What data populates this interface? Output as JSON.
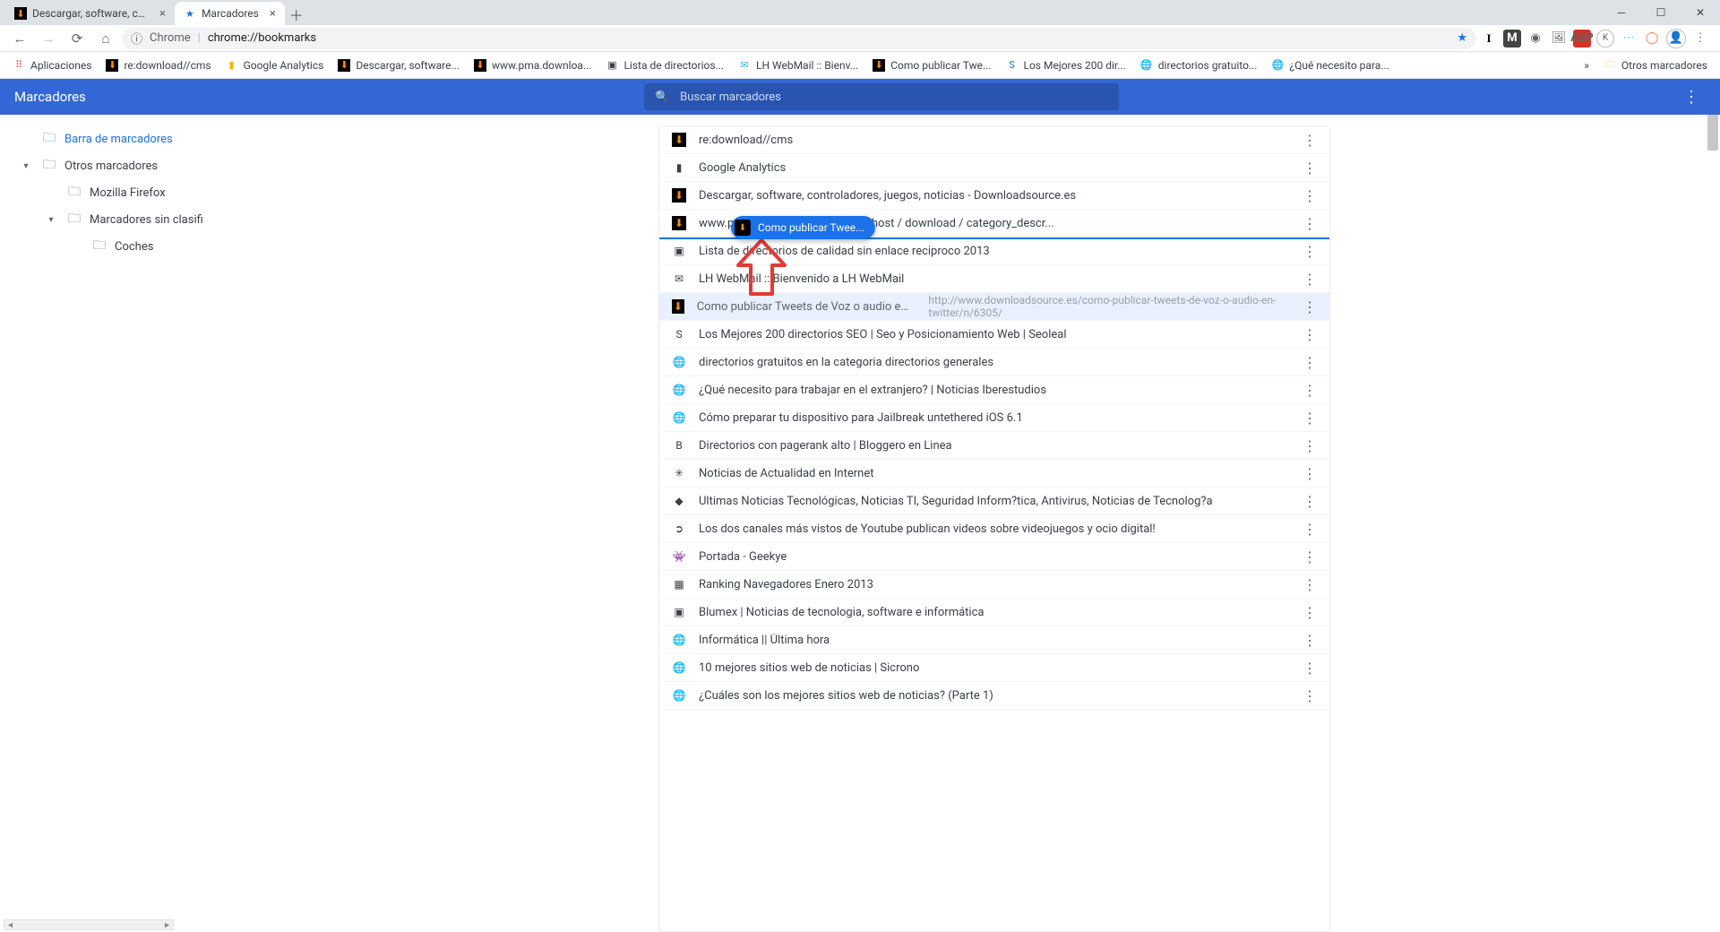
{
  "tabs": [
    {
      "label": "Descargar, software, controlador",
      "icon_bg": "ic-orange"
    },
    {
      "label": "Marcadores",
      "icon_bg": "ic-blue-star"
    }
  ],
  "address": {
    "scheme": "Chrome",
    "path": "chrome://bookmarks"
  },
  "bookbar": {
    "apps": "Aplicaciones",
    "items": [
      "re:download//cms",
      "Google Analytics",
      "Descargar, software...",
      "www.pma.downloa...",
      "Lista de directorios...",
      "LH WebMail :: Bienv...",
      "Como publicar Twe...",
      "Los Mejores 200 dir...",
      "directorios gratuito...",
      "¿Qué necesito para..."
    ],
    "overflow": "»",
    "other": "Otros marcadores"
  },
  "page": {
    "title": "Marcadores",
    "search_placeholder": "Buscar marcadores"
  },
  "tree": [
    {
      "label": "Barra de marcadores",
      "level": 0,
      "active": true,
      "caret": ""
    },
    {
      "label": "Otros marcadores",
      "level": 1,
      "active": false,
      "caret": "▾"
    },
    {
      "label": "Mozilla Firefox",
      "level": 2,
      "active": false,
      "caret": ""
    },
    {
      "label": "Marcadores sin clasifi",
      "level": 2,
      "active": false,
      "caret": "▾"
    },
    {
      "label": "Coches",
      "level": 3,
      "active": false,
      "caret": ""
    }
  ],
  "drag_chip": "Como publicar Twee...",
  "list": [
    {
      "title": "re:download//cms",
      "fav": "⬇",
      "fav_cls": "ic-orange"
    },
    {
      "title": "Google Analytics",
      "fav": "▮",
      "fav_cls": ""
    },
    {
      "title": "Descargar, software, controladores, juegos, noticias - Downloadsource.es",
      "fav": "⬇",
      "fav_cls": "ic-orange"
    },
    {
      "title": "www.pma.download.net.pl / localhost / download / category_descr...",
      "fav": "⬇",
      "fav_cls": "ic-orange"
    },
    {
      "title": "Lista de directorios de calidad sin enlace reciproco 2013",
      "fav": "▣",
      "fav_cls": ""
    },
    {
      "title": "LH WebMail :: Bienvenido a LH WebMail",
      "fav": "✉",
      "fav_cls": ""
    },
    {
      "title": "Como publicar Tweets de Voz o audio en Twitter.",
      "url": "http://www.downloadsource.es/como-publicar-tweets-de-voz-o-audio-en-twitter/n/6305/",
      "fav": "⬇",
      "fav_cls": "ic-orange",
      "selected": true
    },
    {
      "title": "Los Mejores 200 directorios SEO | Seo y Posicionamiento Web | Seoleal",
      "fav": "S",
      "fav_cls": ""
    },
    {
      "title": "directorios gratuitos en la categoria directorios generales",
      "fav": "🌐",
      "fav_cls": "ic-globe"
    },
    {
      "title": "¿Qué necesito para trabajar en el extranjero? | Noticias Iberestudios",
      "fav": "🌐",
      "fav_cls": "ic-globe"
    },
    {
      "title": "Cómo preparar tu dispositivo para Jailbreak untethered iOS 6.1",
      "fav": "🌐",
      "fav_cls": "ic-globe"
    },
    {
      "title": "Directorios con pagerank alto | Bloggero en Linea",
      "fav": "B",
      "fav_cls": ""
    },
    {
      "title": "Noticias de Actualidad en Internet",
      "fav": "✳",
      "fav_cls": ""
    },
    {
      "title": "Ultimas Noticias Tecnológicas, Noticias TI, Seguridad Inform?tica, Antivirus, Noticias de Tecnolog?a",
      "fav": "◆",
      "fav_cls": ""
    },
    {
      "title": "Los dos canales más vistos de Youtube publican videos sobre videojuegos y ocio digital!",
      "fav": "➲",
      "fav_cls": ""
    },
    {
      "title": "Portada - Geekye",
      "fav": "👾",
      "fav_cls": ""
    },
    {
      "title": "Ranking Navegadores Enero 2013",
      "fav": "▦",
      "fav_cls": ""
    },
    {
      "title": "Blumex | Noticias de tecnologia, software e informática",
      "fav": "▣",
      "fav_cls": ""
    },
    {
      "title": "Informática || Última hora",
      "fav": "🌐",
      "fav_cls": "ic-globe"
    },
    {
      "title": "10 mejores sitios web de noticias | Sicrono",
      "fav": "🌐",
      "fav_cls": "ic-globe"
    },
    {
      "title": "¿Cuáles son los mejores sitios web de noticias? (Parte 1)",
      "fav": "🌐",
      "fav_cls": "ic-globe"
    }
  ]
}
